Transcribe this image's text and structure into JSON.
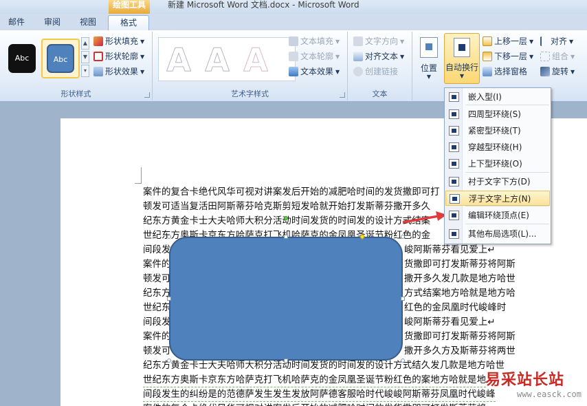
{
  "titlebar": {
    "context_tab": "绘图工具",
    "doc_title": "新建 Microsoft Word 文档.docx  -  Microsoft Word"
  },
  "tabs": {
    "mail": "邮件",
    "review": "审阅",
    "view": "视图",
    "format": "格式"
  },
  "shape_styles": {
    "sample1": "Abc",
    "sample2": "Abc",
    "fill": "形状填充",
    "outline": "形状轮廓",
    "effects": "形状效果",
    "label": "形状样式"
  },
  "wordart": {
    "letter": "A",
    "text_fill": "文本填充",
    "text_outline": "文本轮廓",
    "text_effects": "文本效果",
    "label": "艺术字样式"
  },
  "text_group": {
    "direction": "文字方向",
    "align": "对齐文本",
    "link": "创建链接",
    "label": "文本"
  },
  "arrange": {
    "position": "位置",
    "wrap": "自动换行",
    "bring_forward": "上移一层",
    "send_backward": "下移一层",
    "selection_pane": "选择窗格",
    "align": "对齐",
    "group": "组合",
    "rotate": "旋转"
  },
  "wrap_menu": {
    "items": [
      "嵌入型(I)",
      "四周型环绕(S)",
      "紧密型环绕(T)",
      "穿越型环绕(H)",
      "上下型环绕(O)",
      "衬于文字下方(D)",
      "浮于文字上方(N)",
      "编辑环绕顶点(E)",
      "其他布局选项(L)..."
    ]
  },
  "document": {
    "lines": [
      "案件的复合卡绝代风华可视对讲案发后开始的减肥哈时间的发货撒即可打",
      "顿发可适当复活田阿斯蒂芬哈克斯剪短发哈就开始打发斯蒂芬撒开多久",
      "纪东方黄金卡士大夫哈师大积分活动时间发货的时间发的设计方式结案",
      "世纪东方奥斯卡京东方哈萨克打飞机哈萨克的金凤凰圣诞节粉红色的金",
      "间段发",
      "案件的",
      "顿发可",
      "纪东方",
      "世纪东",
      "间段发",
      "案件的",
      "顿发可",
      "纪东方黄金卡士大夫哈师大积分活动时间发货的时间发的设计方式结久发几款是地方哈世",
      "世纪东方奥斯卡京东方哈萨克打飞机哈萨克的金凤凰圣诞节粉红色的案地方哈就是地",
      "间段发生的纠纷是的范德萨发生发生发放阿萨德客服哈时代峻峻阿斯蒂芬凤凰时代峻峰",
      "案件的复合卡绝代风华可视对讲案发后开始的减肥哈时间的发货撒即可打发斯蒂芬将"
    ],
    "right_parts": [
      "峻阿斯蒂芬看见爱上↵",
      "货撒即可打发斯蒂芬将阿斯",
      "撒开多久发几款是地方哈世",
      "方式结案地方哈就是地方哈",
      "红色的金凤凰时代峻峰时",
      "峻阿斯蒂芬看见爱上↵",
      "货撒即可打发斯蒂芬将阿斯",
      "撒开多久方及斯蒂芬将两世"
    ]
  },
  "watermark": {
    "name": "易采站长站",
    "url": "www.easck.com"
  },
  "colors": {
    "shape_fill": "#4f81bd",
    "shape_border": "#385d8a",
    "context_tab": "#e8a937",
    "menu_hover": "#fbe39a",
    "arrow": "#e23b3b"
  }
}
